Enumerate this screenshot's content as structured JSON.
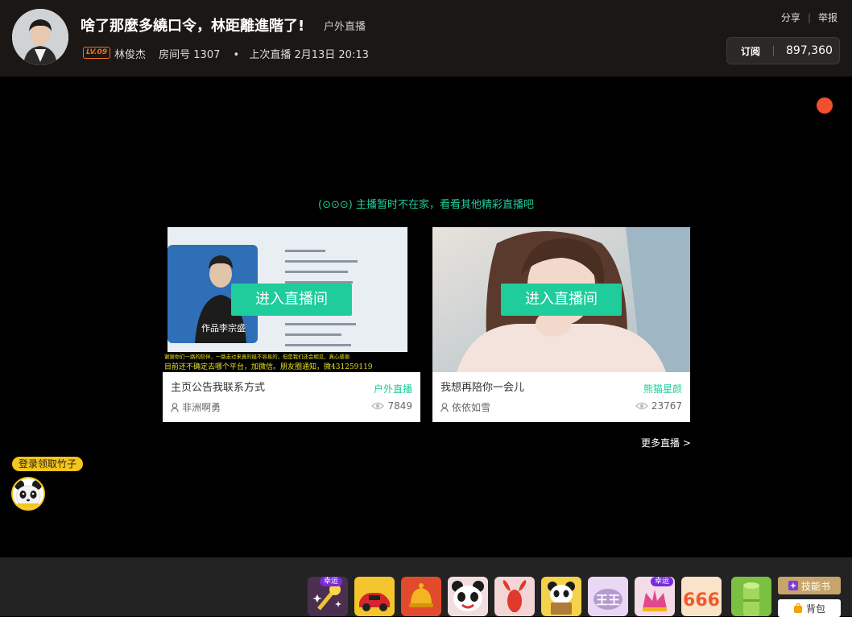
{
  "header": {
    "title": "啥了那麼多繞口令，林距離進階了!",
    "category": "户外直播",
    "level": "LV.09",
    "streamer": "林俊杰",
    "room_label": "房间号 1307",
    "last_live": "上次直播 2月13日 20:13",
    "share": "分享",
    "report": "举报",
    "subscribe_label": "订阅",
    "subscribe_count": "897,360"
  },
  "player": {
    "notice": "(⊙⊙⊙) 主播暂时不在家，看看其他精彩直播吧",
    "cards": [
      {
        "enter_label": "进入直播间",
        "title": "主页公告我联系方式",
        "category": "户外直播",
        "user": "非洲啊勇",
        "views": "7849",
        "thumb_caption": "作品李宗盛",
        "subtitle1": "谢谢你们一路的陪伴，一路走过来真的挺不容易的，但是我们还会相见，真心感谢",
        "subtitle2": "目前还不确定去哪个平台，加微信。朋友圈通知，微431259119"
      },
      {
        "enter_label": "进入直播间",
        "title": "我想再陪你一会儿",
        "category": "熊猫星颜",
        "user": "依依如雪",
        "views": "23767"
      }
    ],
    "more_live": "更多直播 >",
    "login_bubble": "登录领取竹子"
  },
  "giftbar": {
    "tag_lucky": "幸运",
    "skill_book": "技能书",
    "backpack": "背包",
    "gifts": [
      "magic-wand-gift",
      "red-car-gift",
      "golden-bell-gift",
      "panda-face-gift",
      "crayfish-gift",
      "panda-script-gift",
      "king-gift",
      "lucky-crown-gift",
      "666-gift",
      "bamboo-gift"
    ]
  },
  "colors": {
    "accent": "#1fcc9b",
    "header_bg": "#1a1714",
    "level_orange": "#f56a1c",
    "live_red": "#f05030"
  }
}
